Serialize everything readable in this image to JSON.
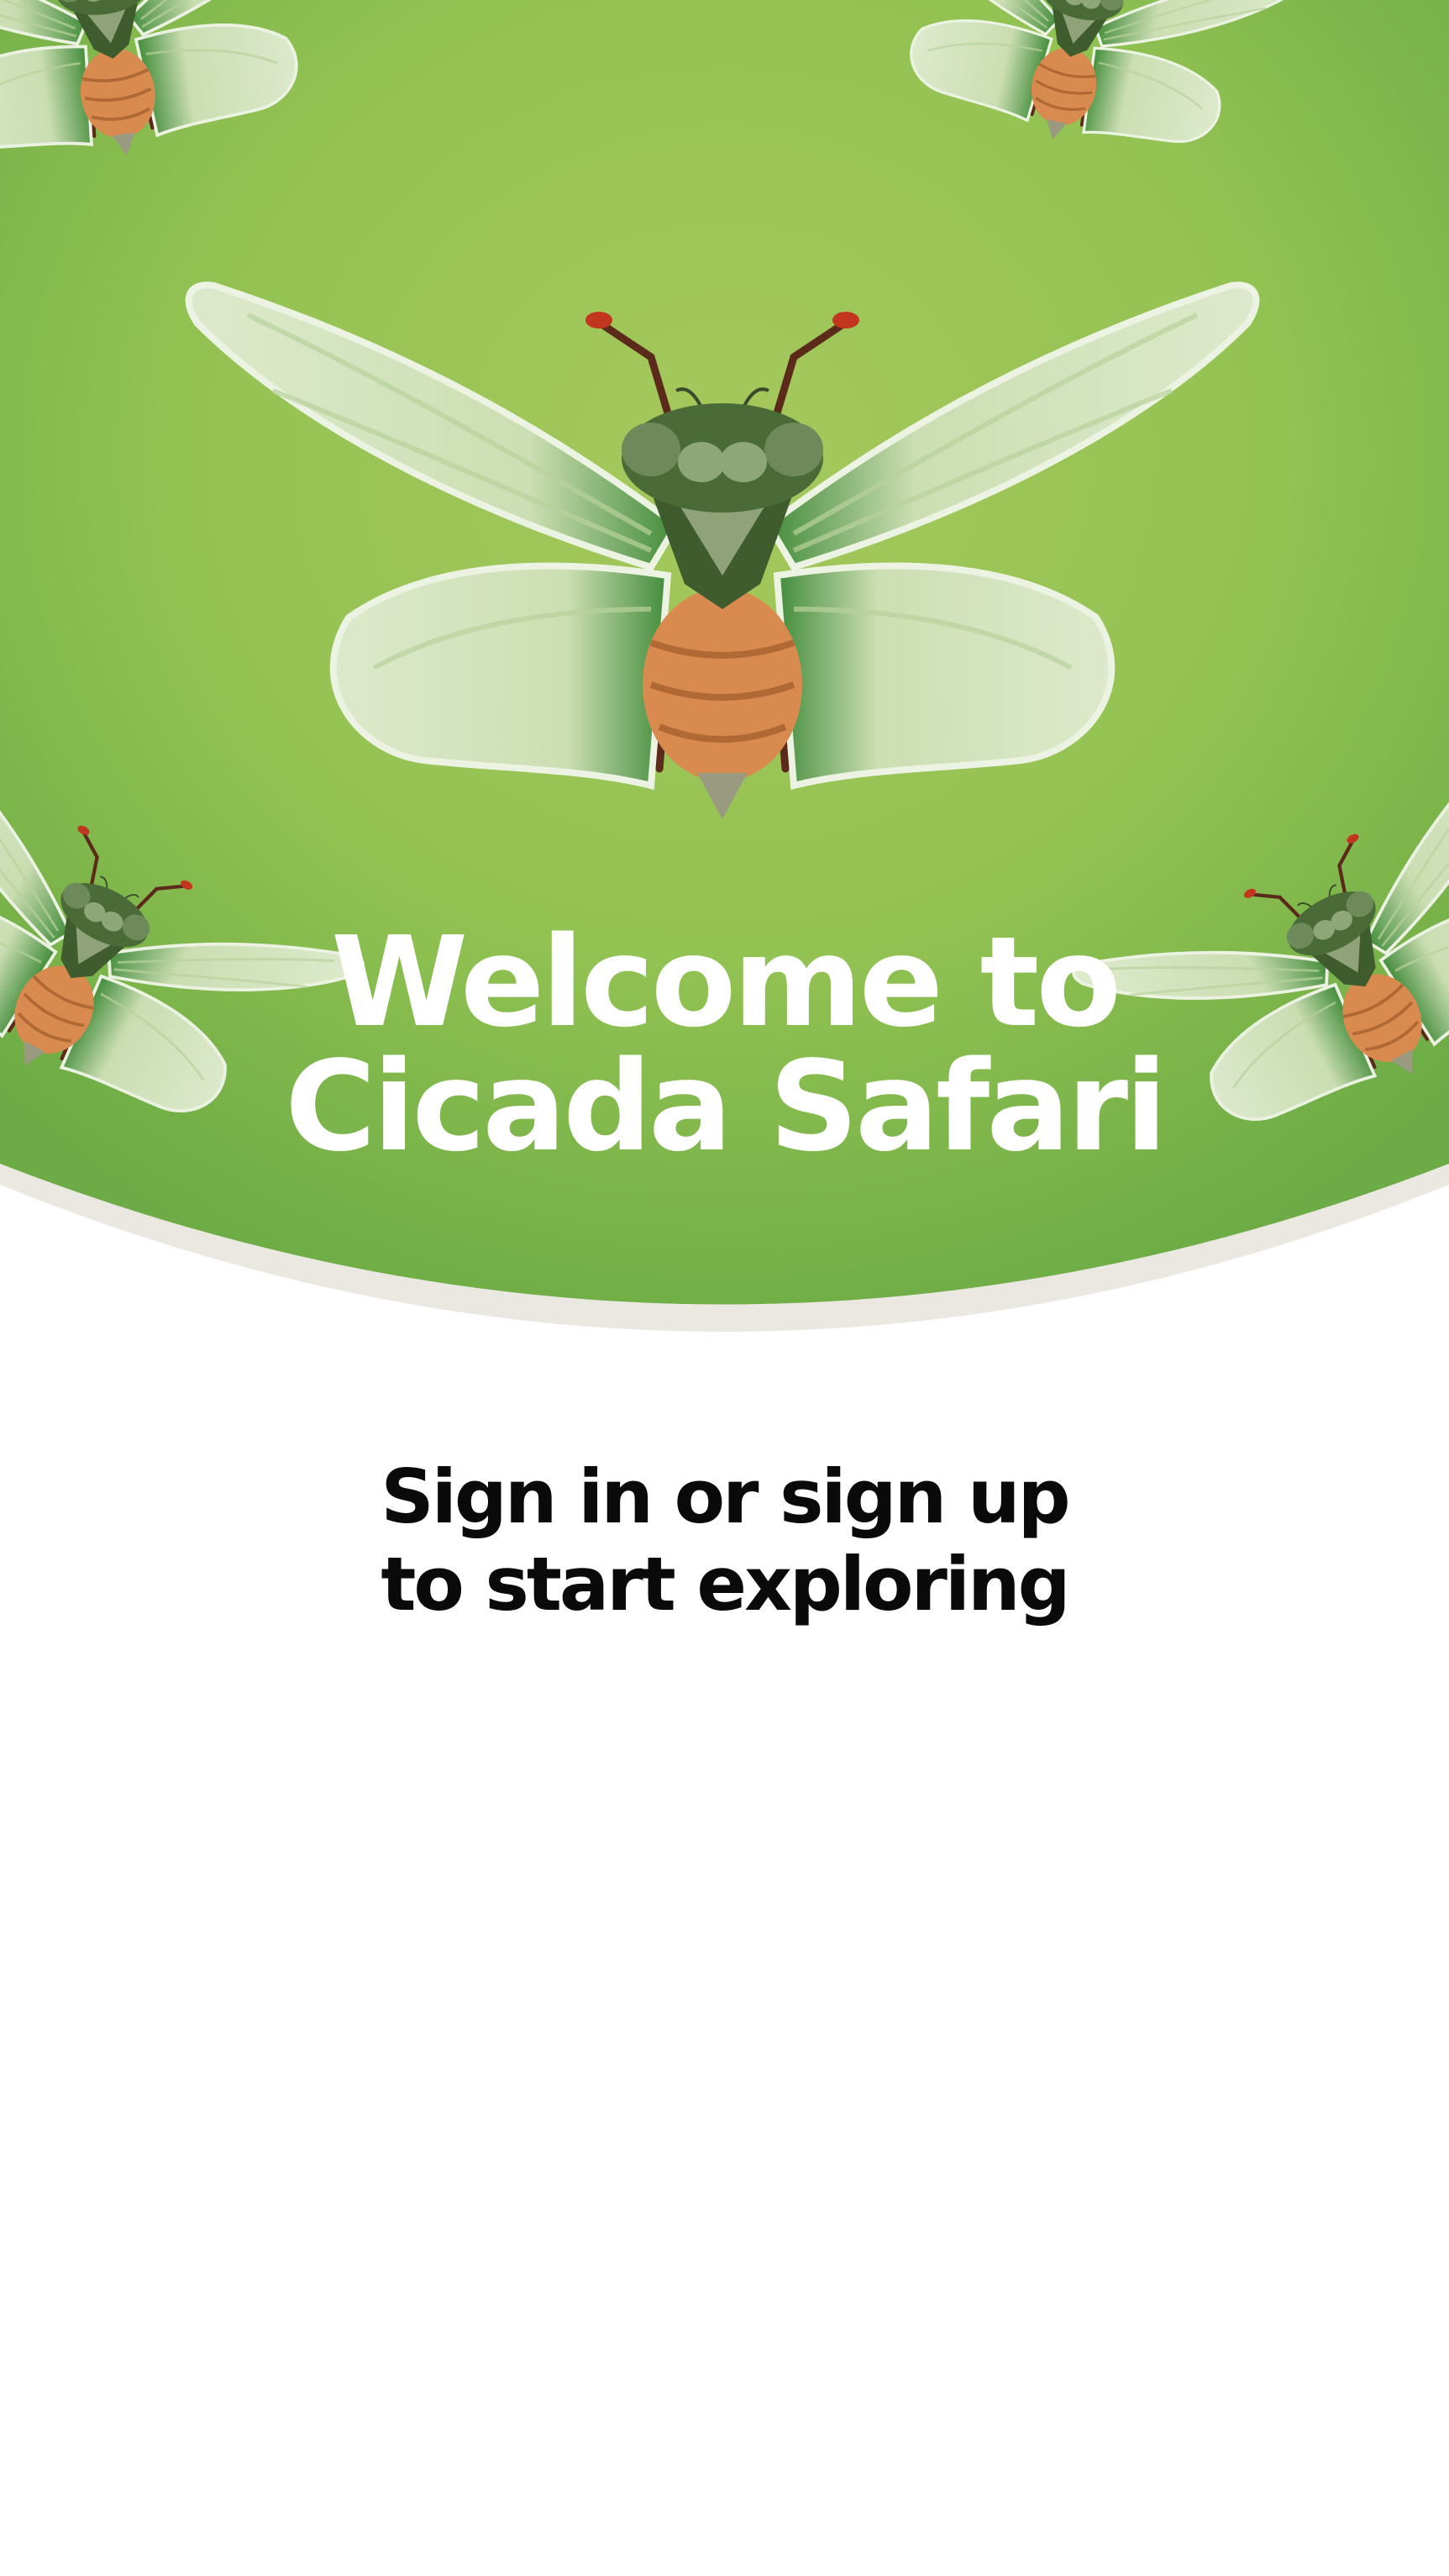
{
  "hero": {
    "title_line1": "Welcome to",
    "title_line2": "Cicada Safari",
    "illustration": "cicada-illustration",
    "colors": {
      "green_light": "#a4c75a",
      "green_mid": "#8dbf4e",
      "green_dark": "#6fae46",
      "arc_border": "#ebe8e1"
    }
  },
  "prompt": {
    "line1": "Sign in or sign up",
    "line2": "to start exploring"
  }
}
